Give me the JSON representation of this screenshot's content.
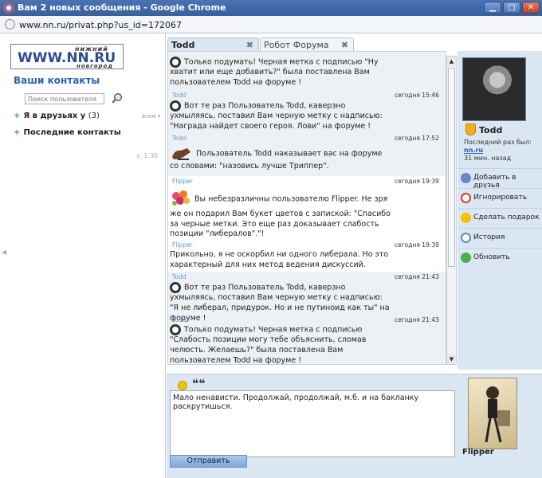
{
  "window": {
    "title": "Вам 2 новых сообщения - Google Chrome",
    "url": "www.nn.ru/privat.php?us_id=172067",
    "btn_min": "▁",
    "btn_max": "□",
    "btn_close": "✕"
  },
  "left": {
    "logo_top": "нижний",
    "logo_main": "WWW.NN.RU",
    "logo_bottom": "новгород",
    "contacts_title": "Ваши контакты",
    "search_placeholder": "Поиск пользователя",
    "groups": [
      {
        "label": "Я в друзьях у",
        "count": "(3)",
        "sort": "всем ▾"
      },
      {
        "label": "Последние контакты",
        "count": ""
      }
    ],
    "version": "v. 1.30"
  },
  "tabs": [
    {
      "label": "Todd",
      "close": "✖"
    },
    {
      "label": "Робот Форума",
      "close": "✖"
    }
  ],
  "messages": [
    {
      "author": "",
      "time": "",
      "text": "Только подумать! Черная метка с подписью \"Ну хватит или еще добавить?\" была поставлена Вам пользователем Todd на форуме !"
    },
    {
      "author": "Todd",
      "time": "сегодня 15:46",
      "text": "Вот те раз Пользователь Todd, каверзно ухмыляясь, поставил Вам черную метку с надписью: \"Награда найдет своего героя. Лови\" на форуме !"
    },
    {
      "author": "Todd",
      "time": "сегодня 17:52",
      "text": "Пользователь Todd наказывает вас на форуме со словами: \"назовись лучше Триппер\"."
    },
    {
      "author": "Flipper",
      "time": "сегодня 19:39",
      "text": "Вы небезразличны пользователю Flipper. Не зря же он подарил Вам букет цветов с запиской: \"Спасибо за черные метки. Это еще раз доказывает слабость позиции \"либералов\".\"!"
    },
    {
      "author": "Flipper",
      "time": "сегодня 19:39",
      "text": "Прикольно, я не оскорбил ни одного либерала. Но это характерный для них метод ведения дискуссий."
    },
    {
      "author": "Todd",
      "time": "сегодня 21:43",
      "text": "Вот те раз Пользователь Todd, каверзно ухмыляясь, поставил Вам черную метку с надписью: \"Я не либерал, придурок. Но и не путиноид как ты\" на форуме !"
    },
    {
      "author": "Todd",
      "time": "сегодня 21:43",
      "text": "Только подумать! Черная метка с подписью \"Слабость позиции могу тебе объяснить, сломав челюсть. Желаешь?\" была поставлена Вам пользователем Todd на форуме !"
    }
  ],
  "profile": {
    "name": "Todd",
    "last_seen_label": "Последний раз был:",
    "last_seen_site": "nn.ru",
    "last_seen_time": "31 мин. назад"
  },
  "actions": [
    {
      "label": "Добавить в друзья",
      "icon": "add-friend-icon",
      "color": "#6a86c4"
    },
    {
      "label": "Игнорировать",
      "icon": "ignore-icon",
      "color": "#d73a2a"
    },
    {
      "label": "Сделать подарок",
      "icon": "gift-icon",
      "color": "#f2c200"
    },
    {
      "label": "История",
      "icon": "history-icon",
      "color": "#5a8fd0"
    },
    {
      "label": "Обновить",
      "icon": "refresh-icon",
      "color": "#4caf4c"
    }
  ],
  "compose": {
    "quote_symbol": "❝❝",
    "text": "Мало ненависти. Продолжай, продолжай, м.б. и на бакланку  раскрутишься.",
    "send_label": "Отправить",
    "friend_name": "Flipper"
  }
}
